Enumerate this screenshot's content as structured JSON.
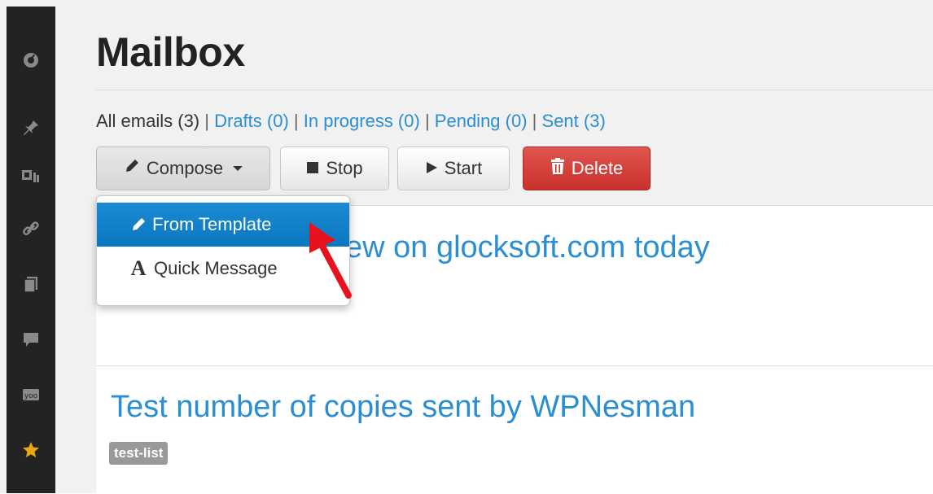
{
  "sidebar": {
    "items": [
      {
        "icon": "dashboard-icon"
      },
      {
        "icon": "pin-icon"
      },
      {
        "icon": "media-icon"
      },
      {
        "icon": "link-icon"
      },
      {
        "icon": "pages-icon"
      },
      {
        "icon": "comments-icon"
      },
      {
        "icon": "yoo-icon"
      },
      {
        "icon": "star-icon"
      }
    ],
    "colors": {
      "background": "#232323",
      "icon": "#8a8a8a",
      "star": "#e6a817"
    }
  },
  "page": {
    "title": "Mailbox"
  },
  "filters": {
    "all": "All emails (3)",
    "separator": "|",
    "drafts": "Drafts (0)",
    "in_progress": "In progress (0)",
    "pending": "Pending (0)",
    "sent": "Sent (3)"
  },
  "toolbar": {
    "compose_label": "Compose",
    "stop_label": "Stop",
    "start_label": "Start",
    "delete_label": "Delete"
  },
  "dropdown": {
    "items": [
      {
        "label": "From Template",
        "icon": "pencil-icon",
        "active": true
      },
      {
        "label": "Quick Message",
        "icon": "font-a-icon",
        "active": false
      }
    ]
  },
  "mails": [
    {
      "title": "ew on glocksoft.com today"
    },
    {
      "title": "Test number of copies sent by WPNesman",
      "tag": "test-list"
    }
  ],
  "colors": {
    "link": "#2a8ed3",
    "danger": "#c9302c",
    "active_item": "#0a78c0",
    "annotation_arrow": "#e8121e"
  }
}
